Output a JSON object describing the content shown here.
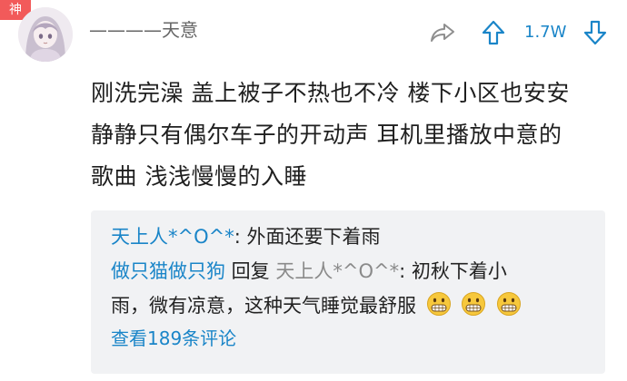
{
  "badge": "神",
  "author": {
    "name": "————天意"
  },
  "actions": {
    "vote_count": "1.7W"
  },
  "post": {
    "lines": [
      "刚洗完澡 盖上被子不热也不冷  楼下小区也安安",
      "静静只有偶尔车子的开动声  耳机里播放中意的",
      "歌曲  浅浅慢慢的入睡"
    ]
  },
  "replies": {
    "first": {
      "user": "天上人*^O^*",
      "sep": ":",
      "text": " 外面还要下着雨"
    },
    "second": {
      "user": "做只猫做只狗",
      "reply_word": " 回复 ",
      "target_user": "天上人*^O^*",
      "sep": ": ",
      "text_line1": "初秋下着小",
      "text_line2": "雨，微有凉意，这种天气睡觉最舒服"
    },
    "view_more": "查看189条评论"
  },
  "icons": {
    "share": "share-icon",
    "upvote": "upvote-arrow-icon",
    "downvote": "downvote-arrow-icon",
    "emoji": "grimacing-face-emoji",
    "avatar": "anime-girl-avatar"
  },
  "colors": {
    "accent": "#1a85c8",
    "badge": "#f25a5a",
    "reply_bg": "#f1f2f4"
  }
}
